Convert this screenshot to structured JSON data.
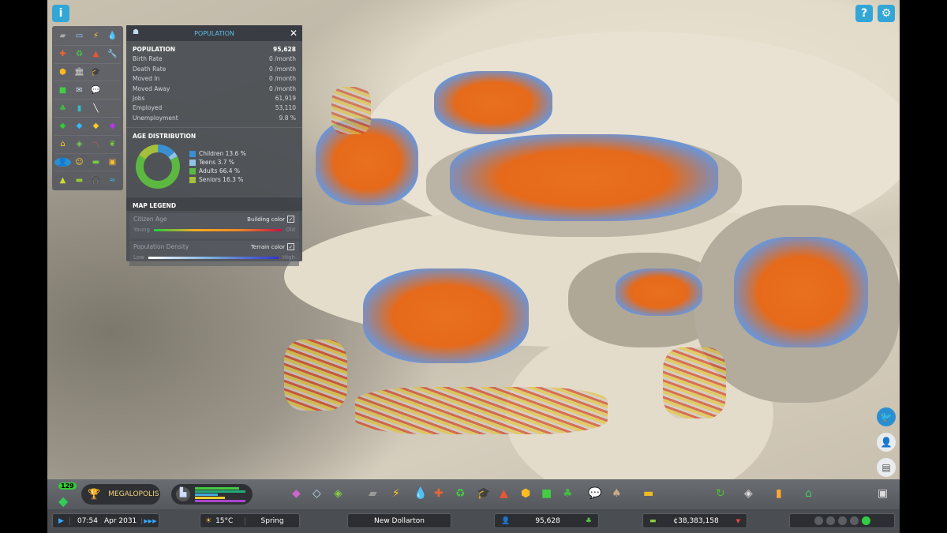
{
  "top": {
    "info_icon": "info-icon",
    "help_icon": "question-icon",
    "settings_icon": "gear-icon"
  },
  "panel": {
    "title": "POPULATION",
    "close": "✕",
    "stats": [
      {
        "label": "POPULATION",
        "value": "95,628"
      },
      {
        "label": "Birth Rate",
        "value": "0 /month"
      },
      {
        "label": "Death Rate",
        "value": "0 /month"
      },
      {
        "label": "Moved In",
        "value": "0 /month"
      },
      {
        "label": "Moved Away",
        "value": "0 /month"
      },
      {
        "label": "Jobs",
        "value": "61,919"
      },
      {
        "label": "Employed",
        "value": "53,110"
      },
      {
        "label": "Unemployment",
        "value": "9.8 %"
      }
    ],
    "age_title": "AGE DISTRIBUTION",
    "age": [
      {
        "label": "Children 13.6 %",
        "pct": 13.6,
        "color": "#3a8fd0"
      },
      {
        "label": "Teens 3.7 %",
        "pct": 3.7,
        "color": "#8fc3e6"
      },
      {
        "label": "Adults 66.4 %",
        "pct": 66.4,
        "color": "#5cb840"
      },
      {
        "label": "Seniors 16.3 %",
        "pct": 16.3,
        "color": "#a4c03c"
      }
    ],
    "legend_title": "MAP LEGEND",
    "legend": [
      {
        "name": "Citizen Age",
        "toggle": "Building color",
        "low": "Young",
        "high": "Old"
      },
      {
        "name": "Population Density",
        "toggle": "Terrain color",
        "low": "Low",
        "high": "High"
      }
    ]
  },
  "bottom": {
    "milestone_count": "129",
    "milestone": "MEGALOPOLIS",
    "time": "07:54",
    "date": "Apr 2031",
    "temperature": "15°C",
    "season": "Spring",
    "city_name": "New Dollarton",
    "population": "95,628",
    "money": "¢38,383,158"
  }
}
